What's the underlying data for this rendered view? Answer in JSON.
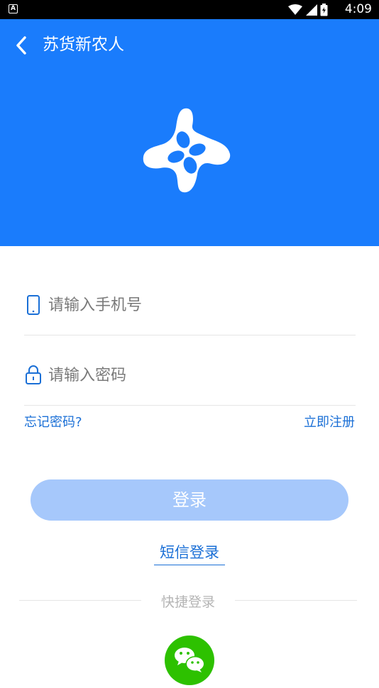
{
  "status_bar": {
    "notification_icon_glyph": "A",
    "time": "4:09"
  },
  "header": {
    "title": "苏货新农人",
    "background_color": "#1a7cfc"
  },
  "form": {
    "phone": {
      "placeholder": "请输入手机号",
      "icon": "phone-icon"
    },
    "password": {
      "placeholder": "请输入密码",
      "icon": "lock-icon"
    },
    "forgot_password": "忘记密码?",
    "register": "立即注册",
    "login_button": "登录",
    "sms_login": "短信登录"
  },
  "quick_login": {
    "label": "快捷登录",
    "wechat_icon": "wechat-icon"
  }
}
